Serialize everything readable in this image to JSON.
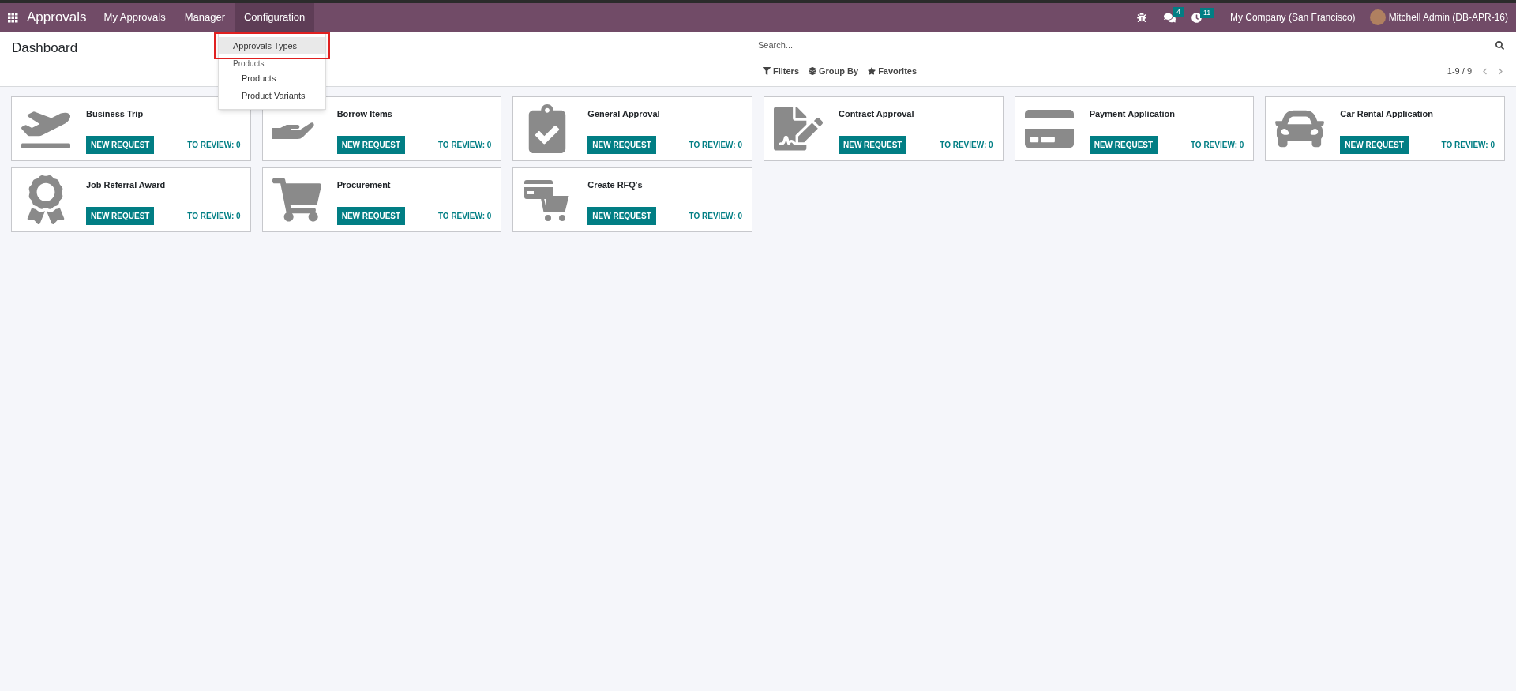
{
  "navbar": {
    "app_name": "Approvals",
    "menus": [
      {
        "label": "My Approvals",
        "selected": false
      },
      {
        "label": "Manager",
        "selected": false
      },
      {
        "label": "Configuration",
        "selected": true
      }
    ],
    "messages_badge": "4",
    "activities_badge": "11",
    "company": "My Company (San Francisco)",
    "user": "Mitchell Admin (DB-APR-16)"
  },
  "dropdown": {
    "items": [
      {
        "kind": "item",
        "label": "Approvals Types",
        "selected": true
      },
      {
        "kind": "header",
        "label": "Products"
      },
      {
        "kind": "subitem",
        "label": "Products",
        "selected": false
      },
      {
        "kind": "subitem",
        "label": "Product Variants",
        "selected": false
      }
    ]
  },
  "control_panel": {
    "title": "Dashboard",
    "search": {
      "placeholder": "Search..."
    },
    "filters": [
      "Filters",
      "Group By",
      "Favorites"
    ],
    "pager": "1-9 / 9"
  },
  "cards": [
    {
      "kind": "plane",
      "title": "Business Trip",
      "button": "NEW REQUEST",
      "review": "TO REVIEW: 0"
    },
    {
      "kind": "hand",
      "title": "Borrow Items",
      "button": "NEW REQUEST",
      "review": "TO REVIEW: 0"
    },
    {
      "kind": "clipboard",
      "title": "General Approval",
      "button": "NEW REQUEST",
      "review": "TO REVIEW: 0"
    },
    {
      "kind": "contract",
      "title": "Contract Approval",
      "button": "NEW REQUEST",
      "review": "TO REVIEW: 0"
    },
    {
      "kind": "card",
      "title": "Payment Application",
      "button": "NEW REQUEST",
      "review": "TO REVIEW: 0"
    },
    {
      "kind": "car",
      "title": "Car Rental Application",
      "button": "NEW REQUEST",
      "review": "TO REVIEW: 0"
    },
    {
      "kind": "award",
      "title": "Job Referral Award",
      "button": "NEW REQUEST",
      "review": "TO REVIEW: 0"
    },
    {
      "kind": "cart",
      "title": "Procurement",
      "button": "NEW REQUEST",
      "review": "TO REVIEW: 0"
    },
    {
      "kind": "rfq",
      "title": "Create RFQ's",
      "button": "NEW REQUEST",
      "review": "TO REVIEW: 0"
    }
  ]
}
